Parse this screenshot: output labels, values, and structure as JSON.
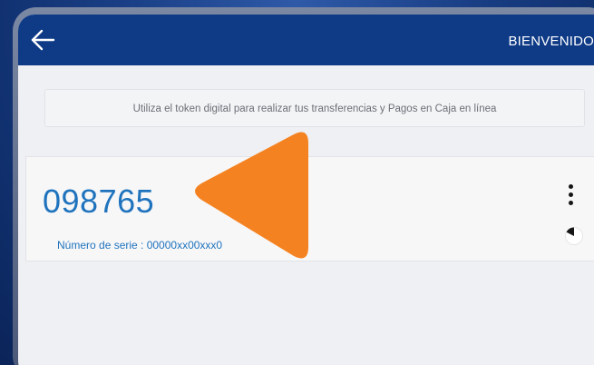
{
  "header": {
    "title": "BIENVENIDO"
  },
  "notice": {
    "text": "Utiliza el token digital para realizar tus transferencias y Pagos en Caja en línea"
  },
  "token": {
    "code": "098765",
    "serial_label": "Número de serie : 00000xx00xxx0"
  },
  "icons": {
    "back": "back-arrow-icon",
    "menu": "more-vertical-icon",
    "timer": "countdown-timer-icon",
    "overlay": "play-triangle-icon"
  },
  "colors": {
    "header_bg": "#0e3a86",
    "accent_blue": "#1f73bd",
    "overlay_orange": "#f58220",
    "background": "#eef0f3"
  }
}
